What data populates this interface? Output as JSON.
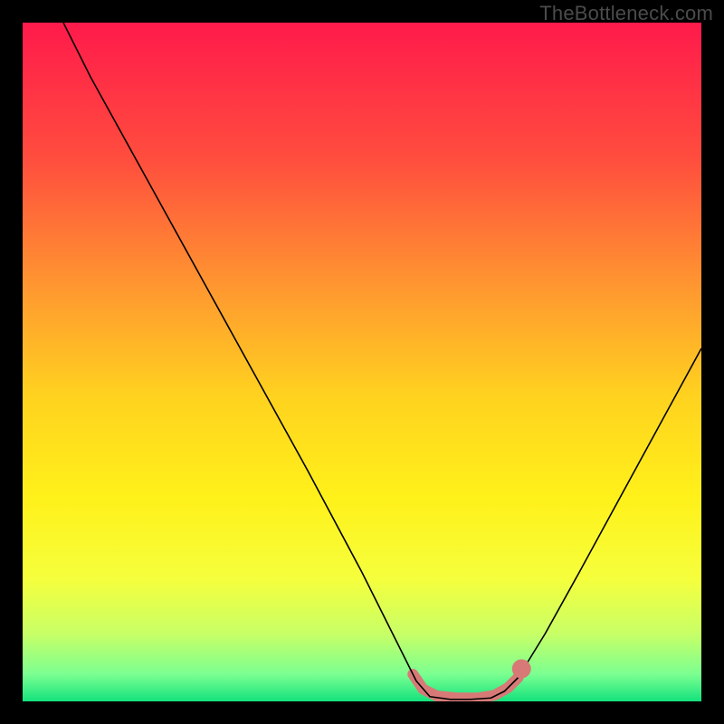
{
  "attribution": "TheBottleneck.com",
  "chart_data": {
    "type": "line",
    "title": "",
    "xlabel": "",
    "ylabel": "",
    "xlim": [
      0,
      100
    ],
    "ylim": [
      0,
      100
    ],
    "background_gradient": {
      "stops": [
        {
          "offset": 0.0,
          "color": "#ff1a4b"
        },
        {
          "offset": 0.2,
          "color": "#ff4d3e"
        },
        {
          "offset": 0.4,
          "color": "#ff9b2f"
        },
        {
          "offset": 0.55,
          "color": "#ffd21f"
        },
        {
          "offset": 0.7,
          "color": "#fff11a"
        },
        {
          "offset": 0.82,
          "color": "#f5ff3d"
        },
        {
          "offset": 0.9,
          "color": "#c8ff66"
        },
        {
          "offset": 0.96,
          "color": "#7bff91"
        },
        {
          "offset": 1.0,
          "color": "#14e27d"
        }
      ]
    },
    "curve": {
      "color": "#000000",
      "width": 1.6,
      "points": [
        {
          "x": 6.0,
          "y": 100.0
        },
        {
          "x": 10.0,
          "y": 92.0
        },
        {
          "x": 18.0,
          "y": 77.5
        },
        {
          "x": 26.0,
          "y": 63.0
        },
        {
          "x": 34.0,
          "y": 48.5
        },
        {
          "x": 42.0,
          "y": 34.0
        },
        {
          "x": 50.0,
          "y": 19.0
        },
        {
          "x": 55.0,
          "y": 9.0
        },
        {
          "x": 58.0,
          "y": 3.0
        },
        {
          "x": 60.0,
          "y": 0.7
        },
        {
          "x": 63.0,
          "y": 0.3
        },
        {
          "x": 66.0,
          "y": 0.3
        },
        {
          "x": 69.0,
          "y": 0.5
        },
        {
          "x": 71.0,
          "y": 1.5
        },
        {
          "x": 73.0,
          "y": 3.5
        },
        {
          "x": 77.0,
          "y": 10.0
        },
        {
          "x": 82.0,
          "y": 19.0
        },
        {
          "x": 88.0,
          "y": 30.0
        },
        {
          "x": 94.0,
          "y": 41.0
        },
        {
          "x": 100.0,
          "y": 52.0
        }
      ]
    },
    "highlight_band": {
      "color": "#d77a77",
      "width": 12,
      "linecap": "round",
      "points": [
        {
          "x": 57.5,
          "y": 4.0
        },
        {
          "x": 59.0,
          "y": 1.8
        },
        {
          "x": 61.0,
          "y": 0.8
        },
        {
          "x": 64.0,
          "y": 0.5
        },
        {
          "x": 67.0,
          "y": 0.5
        },
        {
          "x": 69.5,
          "y": 0.9
        },
        {
          "x": 71.5,
          "y": 2.0
        },
        {
          "x": 73.0,
          "y": 3.5
        }
      ]
    },
    "marker": {
      "x": 73.5,
      "y": 4.8,
      "r": 1.4,
      "color": "#d77a77"
    }
  }
}
